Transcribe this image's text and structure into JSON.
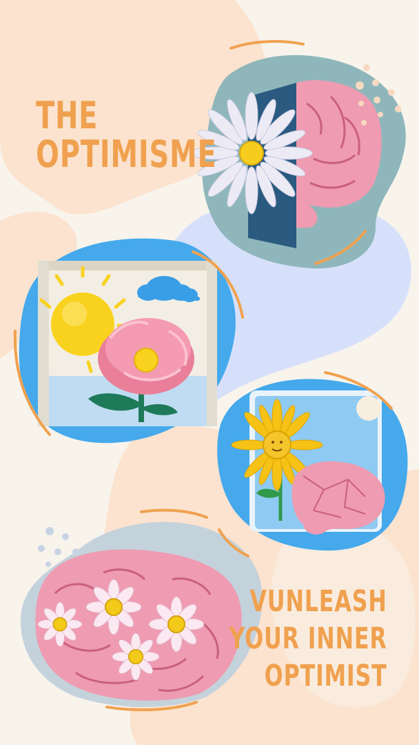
{
  "title_lines": [
    "THE",
    "OPTIMISME"
  ],
  "tagline_lines": [
    "VUNLEASH",
    "YOUR INNER",
    "OPTIMIST"
  ],
  "colors": {
    "background": "#f8f4ec",
    "peach_blob": "#fbe3cf",
    "blue_blob": "#d7e0fb",
    "accent_orange": "#f0a14f",
    "teal_panel": "#8fb7bb",
    "sky_blue": "#45a9ec",
    "brain_pink": "#ef9bb1",
    "sun_yellow": "#f9d21f"
  },
  "illustrations": [
    {
      "name": "daisy-brain-illustration",
      "icon": "daisy-and-brain-icon"
    },
    {
      "name": "sun-flower-frame-illustration",
      "icon": "sun-and-flower-icon"
    },
    {
      "name": "sunflower-brain-frame-illustration",
      "icon": "sunflower-and-brain-icon"
    },
    {
      "name": "flower-brain-illustration",
      "icon": "brain-with-daisies-icon"
    }
  ]
}
